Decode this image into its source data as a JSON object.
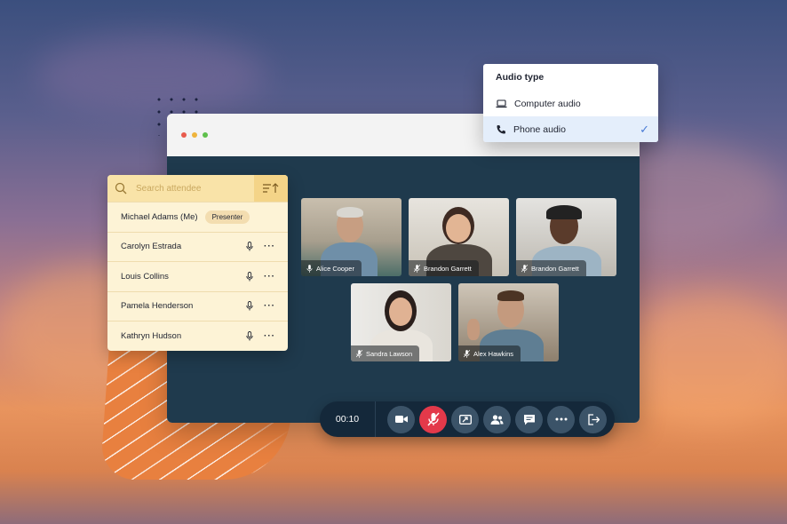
{
  "attendee_panel": {
    "search_placeholder": "Search attendee",
    "attendees": [
      {
        "name": "Michael Adams (Me)",
        "badge": "Presenter"
      },
      {
        "name": "Carolyn Estrada"
      },
      {
        "name": "Louis Collins"
      },
      {
        "name": "Pamela Henderson"
      },
      {
        "name": "Kathryn Hudson"
      }
    ]
  },
  "audio_menu": {
    "title": "Audio type",
    "options": [
      {
        "label": "Computer audio",
        "icon": "laptop-icon",
        "selected": false
      },
      {
        "label": "Phone audio",
        "icon": "phone-icon",
        "selected": true
      }
    ],
    "check_glyph": "✓"
  },
  "video_tiles": [
    {
      "name": "Alice Cooper"
    },
    {
      "name": "Brandon Garrett"
    },
    {
      "name": "Brandon Garrett"
    },
    {
      "name": "Sandra Lawson"
    },
    {
      "name": "Alex Hawkins"
    }
  ],
  "controls": {
    "timer": "00:10",
    "buttons": [
      "video-camera-icon",
      "mic-muted-icon",
      "screen-share-icon",
      "participants-icon",
      "chat-icon",
      "more-icon",
      "leave-icon"
    ]
  },
  "colors": {
    "accent_red": "#e3394a",
    "panel_yellow": "#fdf3d6",
    "stage": "#1f3a4d",
    "control_bar": "#14283a"
  }
}
